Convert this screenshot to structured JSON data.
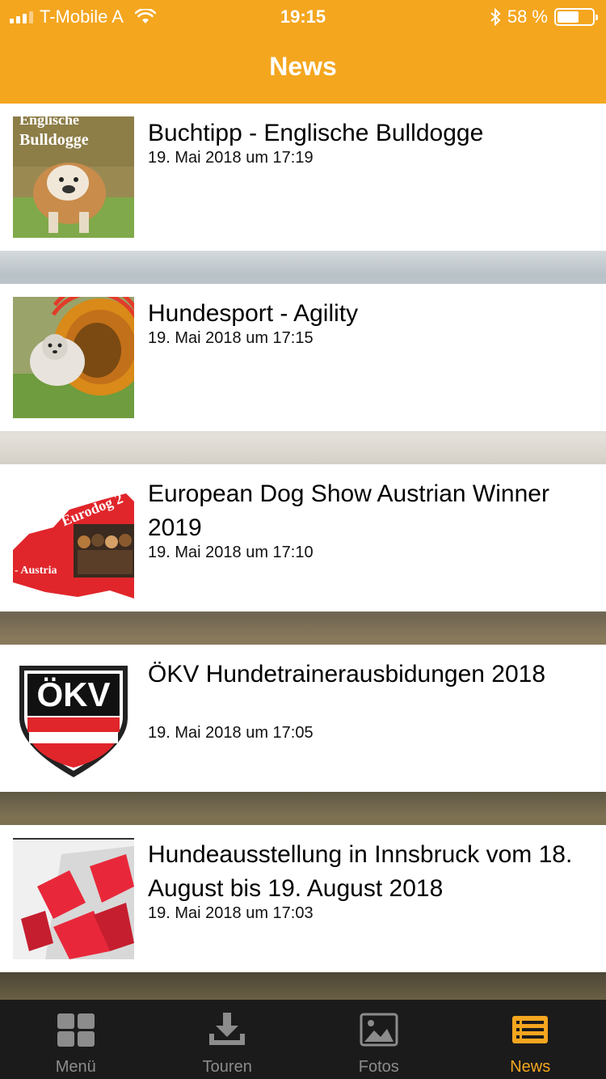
{
  "status_bar": {
    "carrier": "T-Mobile A",
    "time": "19:15",
    "battery": "58 %"
  },
  "header": {
    "title": "News"
  },
  "news": [
    {
      "title": "Buchtipp  - Englische Bulldogge",
      "date": "19. Mai 2018 um 17:19",
      "thumb_text": "Bulldogge",
      "thumb_text_top": "Englische"
    },
    {
      "title": "Hundesport - Agility",
      "date": "19. Mai 2018 um 17:15"
    },
    {
      "title": "European Dog Show Austrian Winner 2019",
      "date": "19. Mai 2018 um 17:10",
      "thumb_text": "Eurodog 2",
      "thumb_text_sub": "- Austria"
    },
    {
      "title": "ÖKV Hundetrainerausbidungen 2018",
      "date": "19. Mai 2018 um 17:05",
      "thumb_text": "ÖKV"
    },
    {
      "title": "Hundeausstellung in Innsbruck vom 18. August bis 19. August 2018",
      "date": "19. Mai 2018 um 17:03"
    }
  ],
  "tabbar": {
    "items": [
      {
        "label": "Menü",
        "icon": "grid-icon"
      },
      {
        "label": "Touren",
        "icon": "download-icon"
      },
      {
        "label": "Fotos",
        "icon": "image-icon"
      },
      {
        "label": "News",
        "icon": "news-icon"
      }
    ],
    "active": "News"
  },
  "colors": {
    "accent": "#f4a61f",
    "tabbar_bg": "#1b1b1b",
    "tab_inactive": "#8c8c8c"
  }
}
